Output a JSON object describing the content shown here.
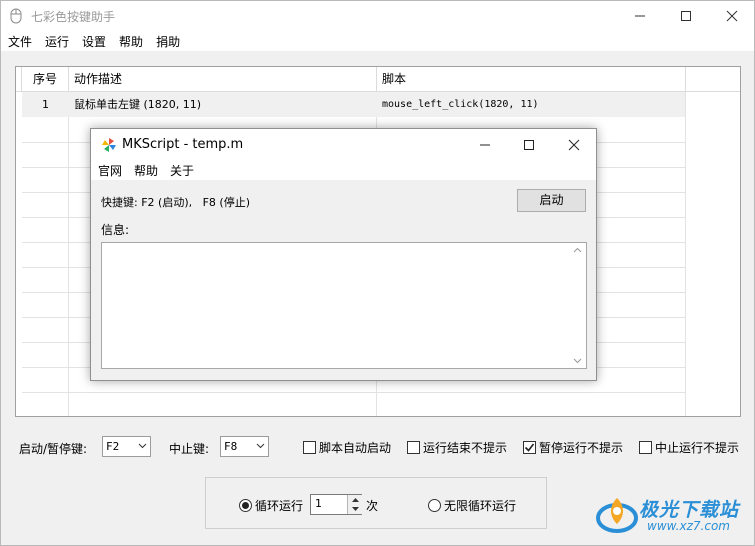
{
  "app": {
    "title": "七彩色按键助手",
    "menu": [
      "文件",
      "运行",
      "设置",
      "帮助",
      "捐助"
    ]
  },
  "table": {
    "columns": [
      "序号",
      "动作描述",
      "脚本"
    ],
    "rows": [
      {
        "index": "1",
        "description": "鼠标单击左键 (1820, 11)",
        "script": "mouse_left_click(1820, 11)"
      }
    ]
  },
  "controls": {
    "start_pause_label": "启动/暂停键:",
    "start_pause_value": "F2",
    "stop_label": "中止键:",
    "stop_value": "F8",
    "checkboxes": [
      {
        "label": "脚本自动启动",
        "checked": false
      },
      {
        "label": "运行结束不提示",
        "checked": false
      },
      {
        "label": "暂停运行不提示",
        "checked": true
      },
      {
        "label": "中止运行不提示",
        "checked": false
      }
    ]
  },
  "loop": {
    "loop_label": "循环运行",
    "loop_selected": true,
    "count_value": "1",
    "count_unit": "次",
    "infinite_label": "无限循环运行",
    "infinite_selected": false
  },
  "dialog": {
    "title": "MKScript - temp.m",
    "menu": [
      "官网",
      "帮助",
      "关于"
    ],
    "hotkey_text": "快捷键: F2 (启动),   F8 (停止)",
    "start_button": "启动",
    "info_label": "信息:",
    "info_text": ""
  },
  "watermark": {
    "title": "极光下载站",
    "url": "www.xz7.com"
  },
  "colors": {
    "watermark_blue": "#2a8fd6",
    "window_bg": "#f0f0f0"
  }
}
